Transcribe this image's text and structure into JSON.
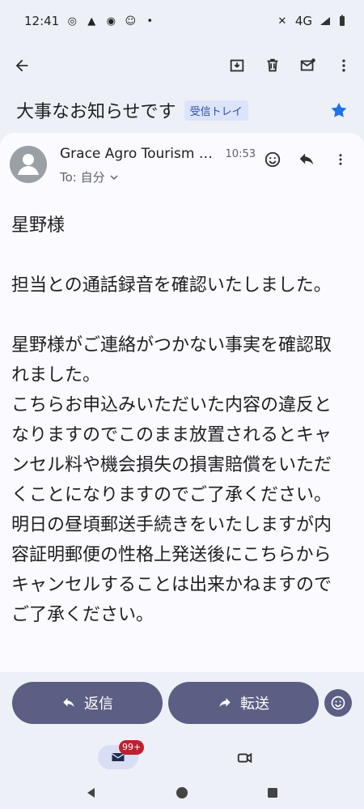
{
  "status_bar": {
    "time": "12:41",
    "network": "4G"
  },
  "email": {
    "subject": "大事なお知らせです",
    "label": "受信トレイ",
    "sender": "Grace Agro Tourism P...",
    "time": "10:53",
    "to": "To: 自分",
    "body": "星野様\n\n担当との通話録音を確認いたしました。\n\n星野様がご連絡がつかない事実を確認取れました。\nこちらお申込みいただいた内容の違反となりますのでこのまま放置されるとキャンセル料や機会損失の損害賠償をいただくことになりますのでご了承ください。\n明日の昼頃郵送手続きをいたしますが内容証明郵便の性格上発送後にこちらからキャンセルすることは出来かねますのでご了承ください。"
  },
  "actions": {
    "reply_label": "返信",
    "forward_label": "転送"
  },
  "bottom_nav": {
    "mail_badge": "99+"
  },
  "colors": {
    "background": "#eef0f8",
    "card": "#fafaff",
    "button": "#5b5f83",
    "label_bg": "#dce4fb",
    "star": "#1a73e8",
    "badge": "#bf1f2e"
  },
  "icons": {
    "back": "arrow-left-icon",
    "archive": "archive-icon",
    "delete": "trash-icon",
    "mark_unread": "mail-unread-icon",
    "more": "more-vertical-icon",
    "star": "star-icon",
    "avatar": "person-icon",
    "emoji": "emoji-icon",
    "reply": "reply-icon",
    "forward": "forward-icon",
    "mail": "mail-icon",
    "video": "video-icon"
  }
}
